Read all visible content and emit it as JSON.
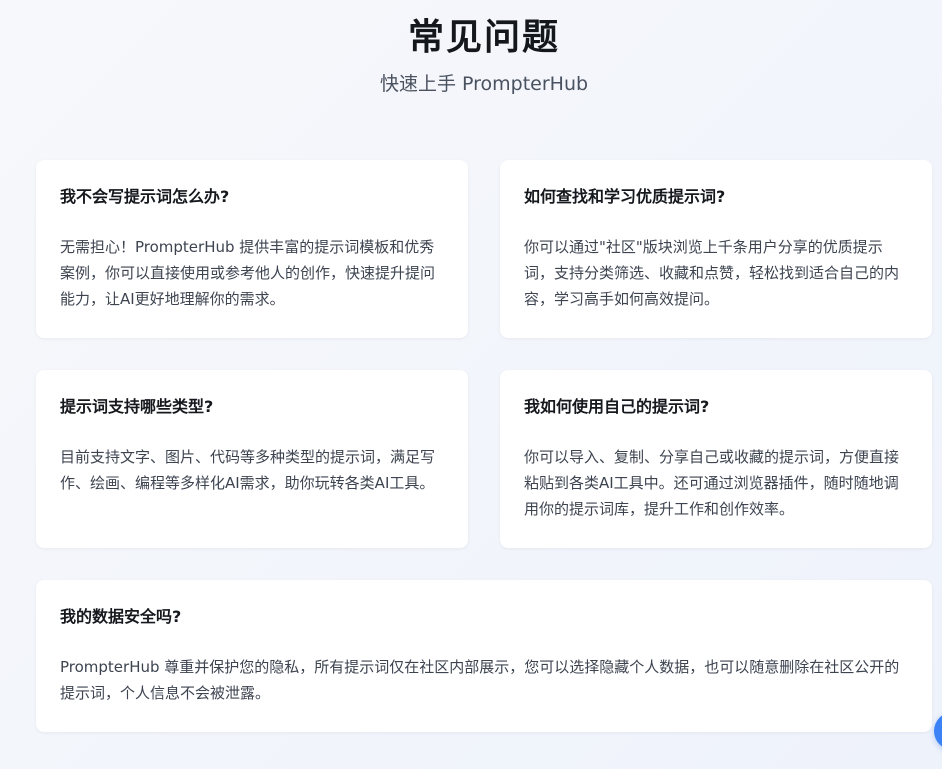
{
  "header": {
    "title": "常见问题",
    "subtitle": "快速上手 PrompterHub"
  },
  "faq": [
    {
      "question": "我不会写提示词怎么办?",
      "answer": "无需担心！PrompterHub 提供丰富的提示词模板和优秀案例，你可以直接使用或参考他人的创作，快速提升提问能力，让AI更好地理解你的需求。"
    },
    {
      "question": "如何查找和学习优质提示词?",
      "answer": "你可以通过\"社区\"版块浏览上千条用户分享的优质提示词，支持分类筛选、收藏和点赞，轻松找到适合自己的内容，学习高手如何高效提问。"
    },
    {
      "question": "提示词支持哪些类型?",
      "answer": "目前支持文字、图片、代码等多种类型的提示词，满足写作、绘画、编程等多样化AI需求，助你玩转各类AI工具。"
    },
    {
      "question": "我如何使用自己的提示词?",
      "answer": "你可以导入、复制、分享自己或收藏的提示词，方便直接粘贴到各类AI工具中。还可通过浏览器插件，随时随地调用你的提示词库，提升工作和创作效率。"
    },
    {
      "question": "我的数据安全吗?",
      "answer": "PrompterHub 尊重并保护您的隐私，所有提示词仅在社区内部展示，您可以选择隐藏个人数据，也可以随意删除在社区公开的提示词，个人信息不会被泄露。"
    }
  ],
  "floating_action": {
    "icon": "floating-action-icon",
    "color": "#3b82f6"
  }
}
